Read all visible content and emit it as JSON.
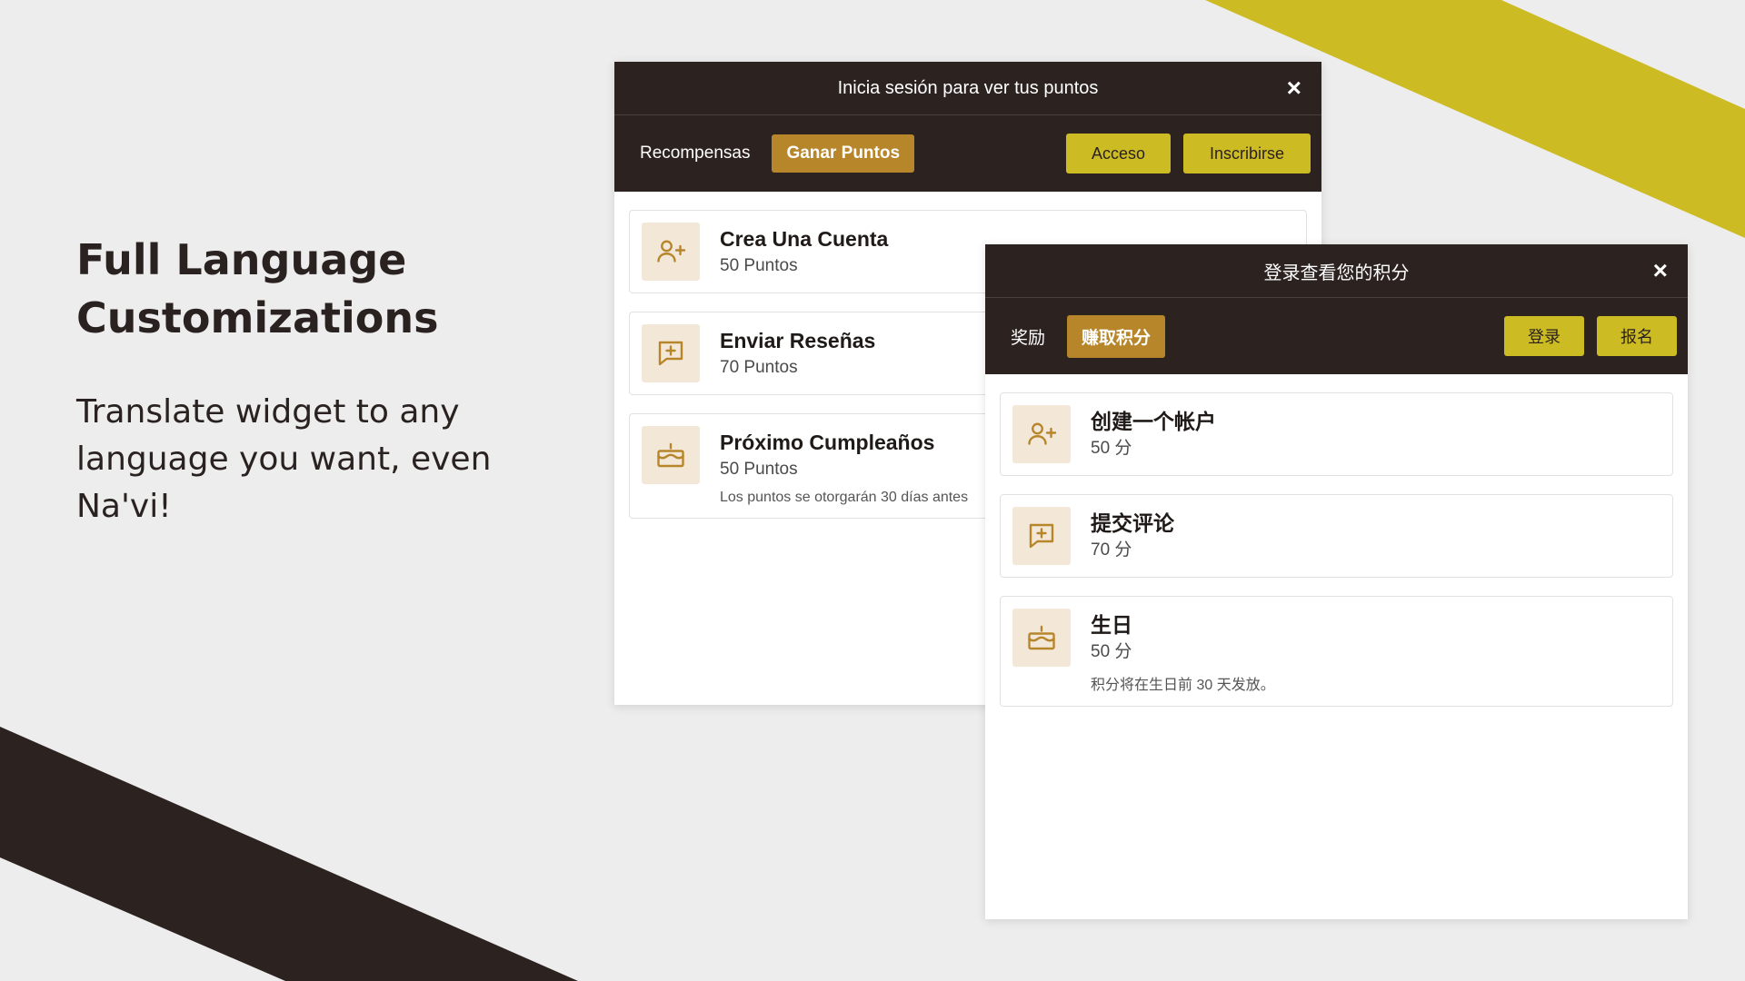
{
  "promo": {
    "title_line1": "Full Language",
    "title_line2": "Customizations",
    "desc_line1": "Translate widget to any",
    "desc_line2": "language you want, even",
    "desc_line3": "Na'vi!"
  },
  "colors": {
    "dark": "#2c2220",
    "accent_gold": "#b8862a",
    "accent_yellow": "#cdbb24",
    "icon_bg": "#f3e8d8",
    "background": "#ededed"
  },
  "widget_es": {
    "header": "Inicia sesión para ver tus puntos",
    "close_icon": "×",
    "tab_rewards": "Recompensas",
    "tab_earn": "Ganar Puntos",
    "login": "Acceso",
    "signup": "Inscribirse",
    "cards": [
      {
        "icon": "user-plus-icon",
        "title": "Crea Una Cuenta",
        "points": "50 Puntos",
        "note": ""
      },
      {
        "icon": "message-plus-icon",
        "title": "Enviar Reseñas",
        "points": "70 Puntos",
        "note": ""
      },
      {
        "icon": "cake-icon",
        "title": "Próximo Cumpleaños",
        "points": "50 Puntos",
        "note": "Los puntos se otorgarán 30 días antes"
      }
    ]
  },
  "widget_zh": {
    "header": "登录查看您的积分",
    "close_icon": "×",
    "tab_rewards": "奖励",
    "tab_earn": "赚取积分",
    "login": "登录",
    "signup": "报名",
    "cards": [
      {
        "icon": "user-plus-icon",
        "title": "创建一个帐户",
        "points": "50 分",
        "note": ""
      },
      {
        "icon": "message-plus-icon",
        "title": "提交评论",
        "points": "70 分",
        "note": ""
      },
      {
        "icon": "cake-icon",
        "title": "生日",
        "points": "50 分",
        "note": "积分将在生日前 30 天发放。"
      }
    ]
  }
}
